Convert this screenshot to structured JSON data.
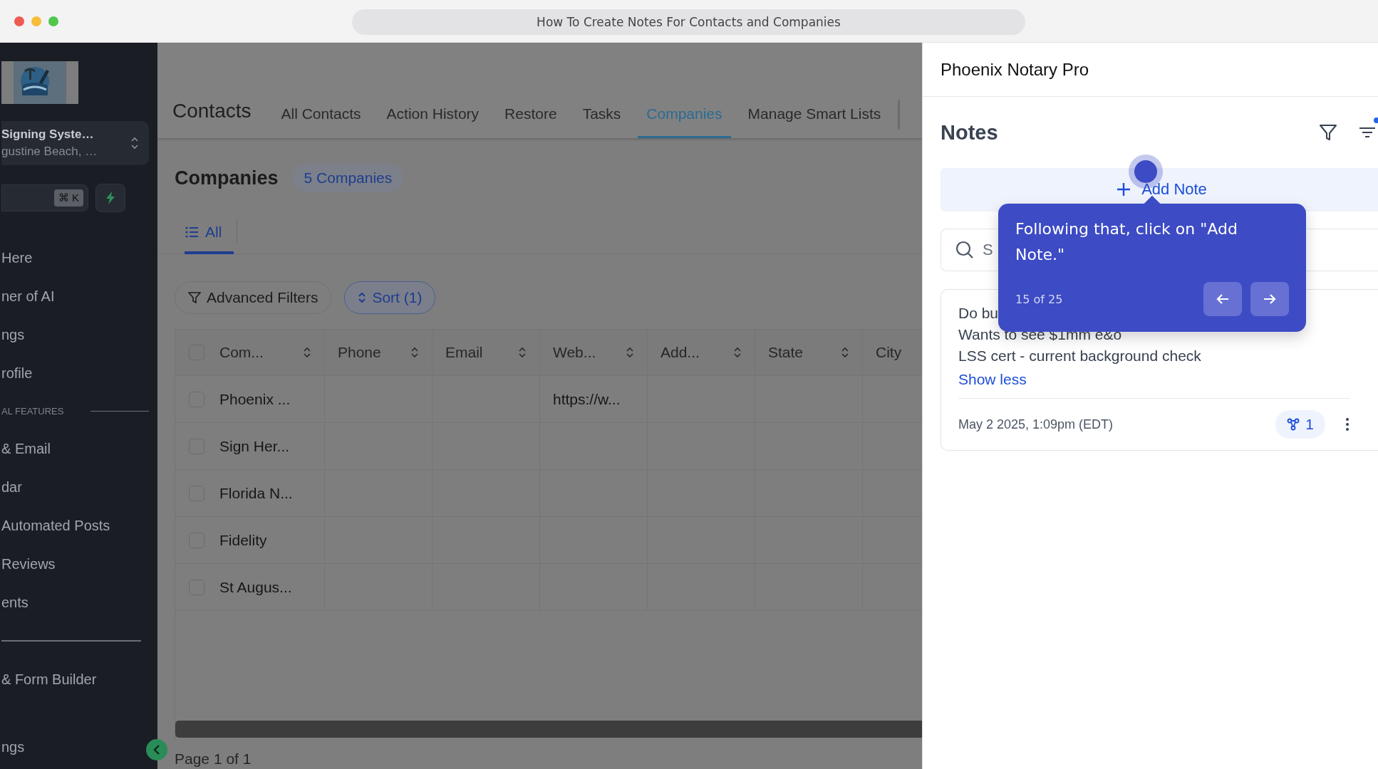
{
  "window": {
    "title": "How To Create Notes For Contacts and Companies"
  },
  "sidebar": {
    "account": {
      "name": "Signing Syste…",
      "location": "gustine Beach, …"
    },
    "search": {
      "shortcut": "⌘ K"
    },
    "items": [
      {
        "kind": "link",
        "label": "Here"
      },
      {
        "kind": "link",
        "label": "ner of AI"
      },
      {
        "kind": "link",
        "label": "ngs"
      },
      {
        "kind": "link",
        "label": "rofile"
      },
      {
        "kind": "section",
        "label": "AL FEATURES"
      },
      {
        "kind": "link",
        "label": "& Email"
      },
      {
        "kind": "link",
        "label": "dar"
      },
      {
        "kind": "link",
        "label": "Automated Posts"
      },
      {
        "kind": "link",
        "label": "Reviews"
      },
      {
        "kind": "link",
        "label": "ents"
      },
      {
        "kind": "divider"
      },
      {
        "kind": "link",
        "label": "& Form Builder"
      },
      {
        "kind": "bottom",
        "label": "ngs"
      }
    ]
  },
  "main": {
    "title": "Contacts",
    "tabs": [
      {
        "label": "All Contacts",
        "selected": false
      },
      {
        "label": "Action History",
        "selected": false
      },
      {
        "label": "Restore",
        "selected": false
      },
      {
        "label": "Tasks",
        "selected": false
      },
      {
        "label": "Companies",
        "selected": true
      },
      {
        "label": "Manage Smart Lists",
        "selected": false
      }
    ],
    "heading": "Companies",
    "count": "5 Companies",
    "views": [
      {
        "label": "All",
        "selected": true
      }
    ],
    "filters": [
      {
        "kind": "filter",
        "label": "Advanced Filters"
      },
      {
        "kind": "sort",
        "label": "Sort (1)"
      }
    ],
    "table": {
      "all_checked": false,
      "columns": [
        {
          "label": "Com...",
          "sortable": true
        },
        {
          "label": "Phone",
          "sortable": true
        },
        {
          "label": "Email",
          "sortable": true
        },
        {
          "label": "Web...",
          "sortable": true
        },
        {
          "label": "Add...",
          "sortable": true
        },
        {
          "label": "State",
          "sortable": true
        },
        {
          "label": "City",
          "sortable": false
        }
      ],
      "rows": [
        {
          "checked": false,
          "company": "Phoenix ...",
          "website": "https://w..."
        },
        {
          "checked": false,
          "company": "Sign Her..."
        },
        {
          "checked": false,
          "company": "Florida N..."
        },
        {
          "checked": false,
          "company": "Fidelity"
        },
        {
          "checked": false,
          "company": "St Augus..."
        }
      ]
    },
    "pagination": "Page 1 of 1"
  },
  "notes_panel": {
    "title": "Phoenix Notary Pro",
    "heading": "Notes",
    "sort_active": true,
    "add_button": "Add Note",
    "search": {
      "placeholder": "S"
    },
    "notes": [
      {
        "lines": [
          "Do bu",
          "Wants to see $1mm e&o",
          "LSS cert - current background check"
        ],
        "toggle": "Show less",
        "date": "May 2 2025, 1:09pm (EDT)",
        "links": "1"
      }
    ]
  },
  "tooltip": {
    "text": "Following that, click on \"Add Note.\"",
    "step": "15 of 25"
  }
}
